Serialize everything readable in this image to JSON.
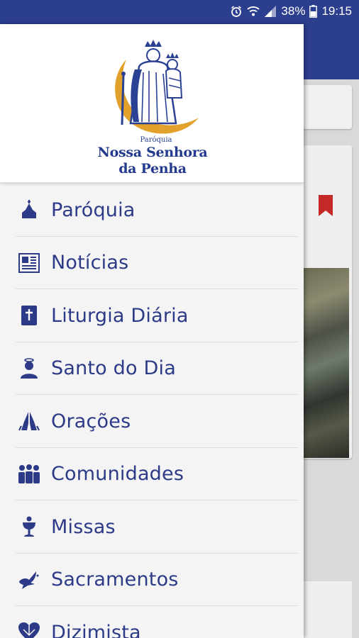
{
  "status_bar": {
    "battery_percent": "38%",
    "time": "19:15",
    "icons": [
      "alarm-icon",
      "wifi-icon",
      "signal-icon",
      "battery-icon"
    ]
  },
  "drawer": {
    "logo": {
      "small_text": "Paróquia",
      "line1": "Nossa Senhora",
      "line2": "da Penha"
    },
    "menu": [
      {
        "label": "Paróquia",
        "icon": "church-icon"
      },
      {
        "label": "Notícias",
        "icon": "newspaper-icon"
      },
      {
        "label": "Liturgia Diária",
        "icon": "bible-icon"
      },
      {
        "label": "Santo do Dia",
        "icon": "saint-icon"
      },
      {
        "label": "Orações",
        "icon": "praying-hands-icon"
      },
      {
        "label": "Comunidades",
        "icon": "community-icon"
      },
      {
        "label": "Missas",
        "icon": "chalice-icon"
      },
      {
        "label": "Sacramentos",
        "icon": "dove-icon"
      },
      {
        "label": "Dizimista",
        "icon": "heart-icon"
      }
    ]
  },
  "colors": {
    "primary": "#2c3e8e",
    "menu_text": "#2c3a87",
    "bookmark": "#c62828",
    "logo_gold": "#e2a12b"
  }
}
